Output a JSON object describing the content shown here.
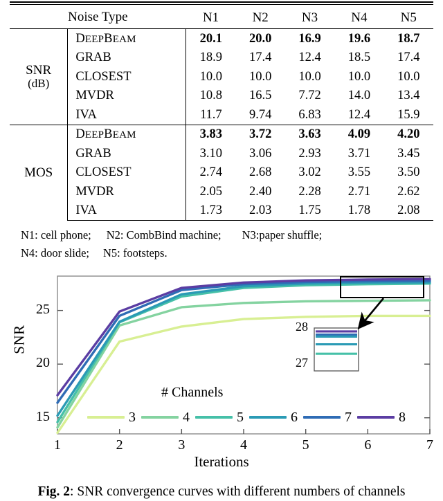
{
  "table": {
    "header": {
      "row_label": "Noise Type",
      "columns": [
        "N1",
        "N2",
        "N3",
        "N4",
        "N5"
      ]
    },
    "groups": [
      {
        "label": "SNR",
        "sub_label": "(dB)",
        "rows": [
          {
            "method": "DeepBeam",
            "smallcaps": true,
            "bold": true,
            "values": [
              "20.1",
              "20.0",
              "16.9",
              "19.6",
              "18.7"
            ]
          },
          {
            "method": "GRAB",
            "smallcaps": false,
            "bold": false,
            "values": [
              "18.9",
              "17.4",
              "12.4",
              "18.5",
              "17.4"
            ]
          },
          {
            "method": "CLOSEST",
            "smallcaps": false,
            "bold": false,
            "values": [
              "10.0",
              "10.0",
              "10.0",
              "10.0",
              "10.0"
            ]
          },
          {
            "method": "MVDR",
            "smallcaps": false,
            "bold": false,
            "values": [
              "10.8",
              "16.5",
              "7.72",
              "14.0",
              "13.4"
            ]
          },
          {
            "method": "IVA",
            "smallcaps": false,
            "bold": false,
            "values": [
              "11.7",
              "9.74",
              "6.83",
              "12.4",
              "15.9"
            ]
          }
        ]
      },
      {
        "label": "MOS",
        "sub_label": "",
        "rows": [
          {
            "method": "DeepBeam",
            "smallcaps": true,
            "bold": true,
            "values": [
              "3.83",
              "3.72",
              "3.63",
              "4.09",
              "4.20"
            ]
          },
          {
            "method": "GRAB",
            "smallcaps": false,
            "bold": false,
            "values": [
              "3.10",
              "3.06",
              "2.93",
              "3.71",
              "3.45"
            ]
          },
          {
            "method": "CLOSEST",
            "smallcaps": false,
            "bold": false,
            "values": [
              "2.74",
              "2.68",
              "3.02",
              "3.55",
              "3.50"
            ]
          },
          {
            "method": "MVDR",
            "smallcaps": false,
            "bold": false,
            "values": [
              "2.05",
              "2.40",
              "2.28",
              "2.71",
              "2.62"
            ]
          },
          {
            "method": "IVA",
            "smallcaps": false,
            "bold": false,
            "values": [
              "1.73",
              "2.03",
              "1.75",
              "1.78",
              "2.08"
            ]
          }
        ]
      }
    ],
    "footnote_line1": "N1: cell phone;",
    "footnote_line1b": "N2: CombBind machine;",
    "footnote_line1c": "N3:paper shuffle;",
    "footnote_line2": "N4: door slide;",
    "footnote_line2b": "N5: footsteps."
  },
  "figure": {
    "caption_prefix": "Fig. 2",
    "caption_text": ": SNR convergence curves with different numbers of channels"
  },
  "chart_data": {
    "type": "line",
    "title": "",
    "xlabel": "Iterations",
    "ylabel": "SNR",
    "legend_title": "# Channels",
    "legend_position": "inside-bottom",
    "grid": false,
    "x": [
      1,
      2,
      3,
      4,
      5,
      6,
      7
    ],
    "xlim": [
      1,
      7
    ],
    "ylim": [
      13.5,
      28.2
    ],
    "xticks": [
      "1",
      "2",
      "3",
      "4",
      "5",
      "6",
      "7"
    ],
    "yticks": [
      "15",
      "20",
      "25"
    ],
    "series": [
      {
        "name": "3",
        "color": "#d8ef93",
        "values": [
          13.6,
          22.1,
          23.5,
          24.2,
          24.4,
          24.5,
          24.5
        ]
      },
      {
        "name": "4",
        "color": "#84d3a0",
        "values": [
          14.1,
          23.6,
          25.3,
          25.7,
          25.85,
          25.9,
          25.95
        ]
      },
      {
        "name": "5",
        "color": "#46c0a8",
        "values": [
          14.6,
          23.9,
          26.3,
          27.1,
          27.35,
          27.45,
          27.5
        ]
      },
      {
        "name": "6",
        "color": "#2b9bb5",
        "values": [
          15.2,
          23.95,
          26.5,
          27.25,
          27.5,
          27.6,
          27.62
        ]
      },
      {
        "name": "7",
        "color": "#2f6cb5",
        "values": [
          16.4,
          24.5,
          26.9,
          27.45,
          27.65,
          27.72,
          27.76
        ]
      },
      {
        "name": "8",
        "color": "#5b3da3",
        "values": [
          17.1,
          24.9,
          27.1,
          27.6,
          27.8,
          27.88,
          27.92
        ]
      }
    ],
    "inset": {
      "yticks": [
        "28",
        "27"
      ],
      "ylim": [
        27,
        28
      ],
      "annotation": "zoom-callout"
    }
  }
}
